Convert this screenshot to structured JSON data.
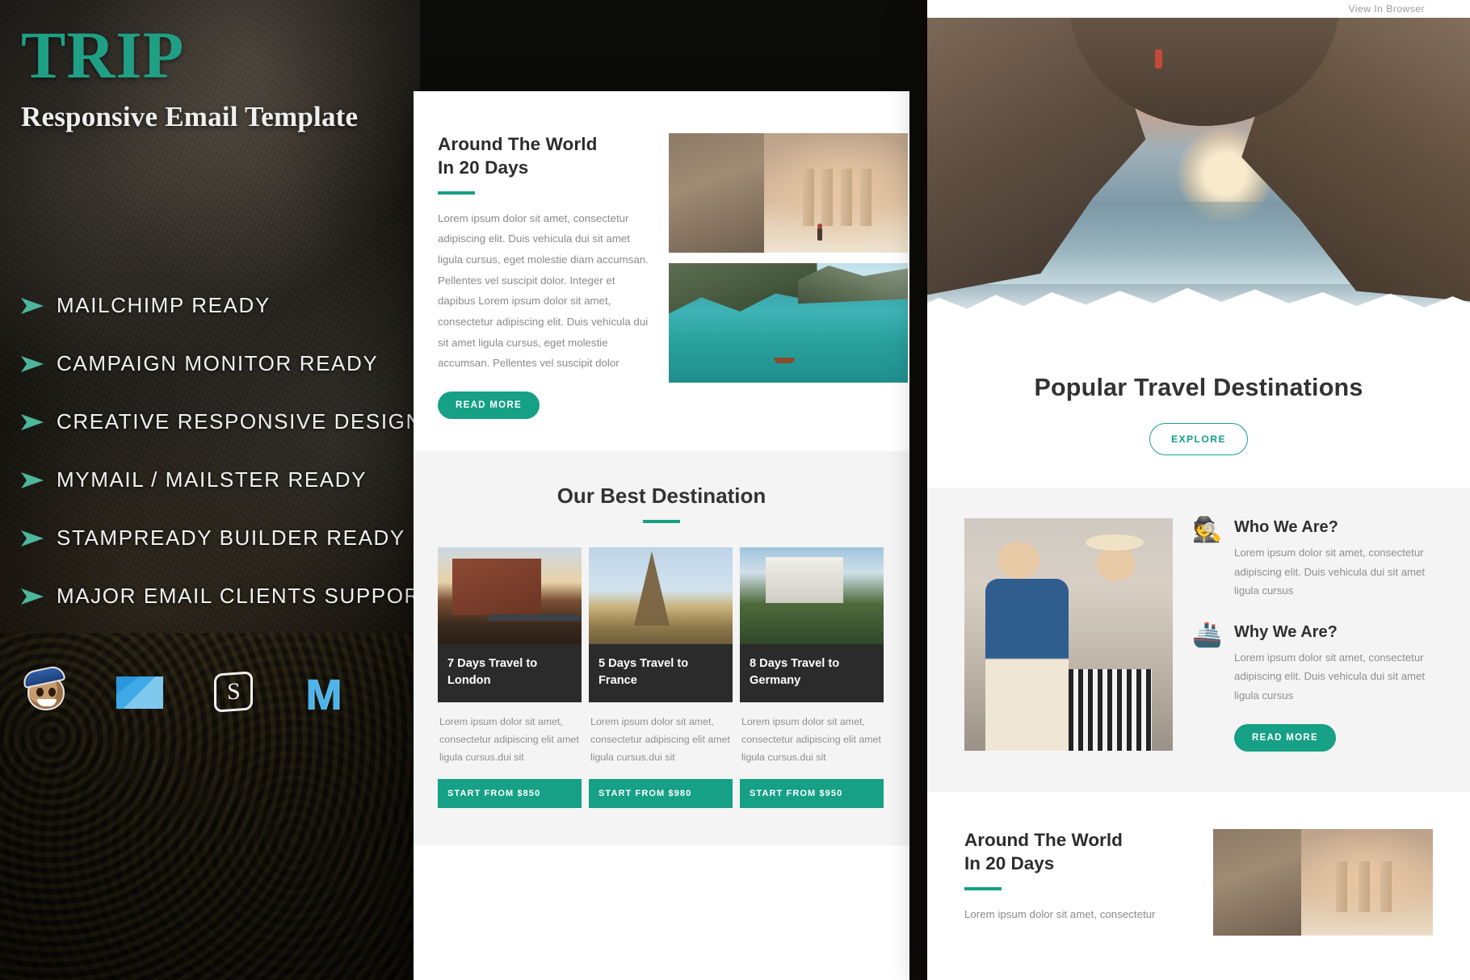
{
  "hero": {
    "brand_title": "TRIP",
    "brand_subtitle": "Responsive Email Template",
    "features": [
      "MAILCHIMP READY",
      "CAMPAIGN MONITOR READY",
      "CREATIVE RESPONSIVE DESIGN",
      "MYMAIL / MAILSTER READY",
      "STAMPREADY BUILDER READY",
      "MAJOR EMAIL CLIENTS SUPPORT"
    ],
    "client_icons": [
      "mailchimp-icon",
      "campaign-monitor-icon",
      "stampready-icon",
      "mymail-icon"
    ],
    "accent_color": "#16a085",
    "brand_color": "#1fa085"
  },
  "middle_email": {
    "article": {
      "heading_line1": "Around The World",
      "heading_line2": "In 20 Days",
      "body": "Lorem ipsum dolor sit amet, consectetur adipiscing elit. Duis vehicula dui sit amet ligula cursus, eget molestie diam accumsan. Pellentes vel suscipit dolor. Integer et dapibus Lorem ipsum dolor sit amet, consectetur adipiscing elit. Duis vehicula dui sit amet ligula cursus, eget molestie accumsan. Pellentes vel suscipit dolor",
      "read_more_label": "READ MORE",
      "images": [
        "petra-treasury-photo",
        "alpine-lake-photo"
      ]
    },
    "best_destination": {
      "title": "Our Best Destination",
      "cards": [
        {
          "image": "hamburg-speicherstadt-photo",
          "title": "7 Days Travel to London",
          "description": "Lorem ipsum dolor sit amet, consectetur adipiscing elit amet ligula cursus.dui sit",
          "price_label": "START FROM $850"
        },
        {
          "image": "eiffel-tower-photo",
          "title": "5 Days Travel to France",
          "description": "Lorem ipsum dolor sit amet, consectetur adipiscing elit amet ligula cursus.dui sit",
          "price_label": "START FROM $980"
        },
        {
          "image": "neuschwanstein-castle-photo",
          "title": "8 Days Travel to Germany",
          "description": "Lorem ipsum dolor sit amet, consectetur adipiscing elit amet ligula cursus.dui sit",
          "price_label": "START FROM $950"
        }
      ]
    }
  },
  "right_email": {
    "view_in_browser": "View In Browser",
    "hero_image": "sea-arch-cliff-photo",
    "headline": "Popular Travel Destinations",
    "explore_label": "EXPLORE",
    "about": {
      "photo": "travel-couple-photo",
      "blocks": [
        {
          "icon": "tourist-icon",
          "emoji": "🕵️",
          "heading": "Who We Are?",
          "text": "Lorem ipsum dolor sit amet, consectetur adipiscing elit. Duis vehicula dui sit amet ligula cursus"
        },
        {
          "icon": "ship-icon",
          "emoji": "🚢",
          "heading": "Why We Are?",
          "text": "Lorem ipsum dolor sit amet, consectetur adipiscing elit. Duis vehicula dui sit amet ligula cursus"
        }
      ],
      "read_more_label": "READ MORE"
    },
    "bottom_article": {
      "heading_line1": "Around The World",
      "heading_line2": "In 20 Days",
      "body": "Lorem ipsum dolor sit amet, consectetur",
      "image": "petra-treasury-photo"
    }
  }
}
